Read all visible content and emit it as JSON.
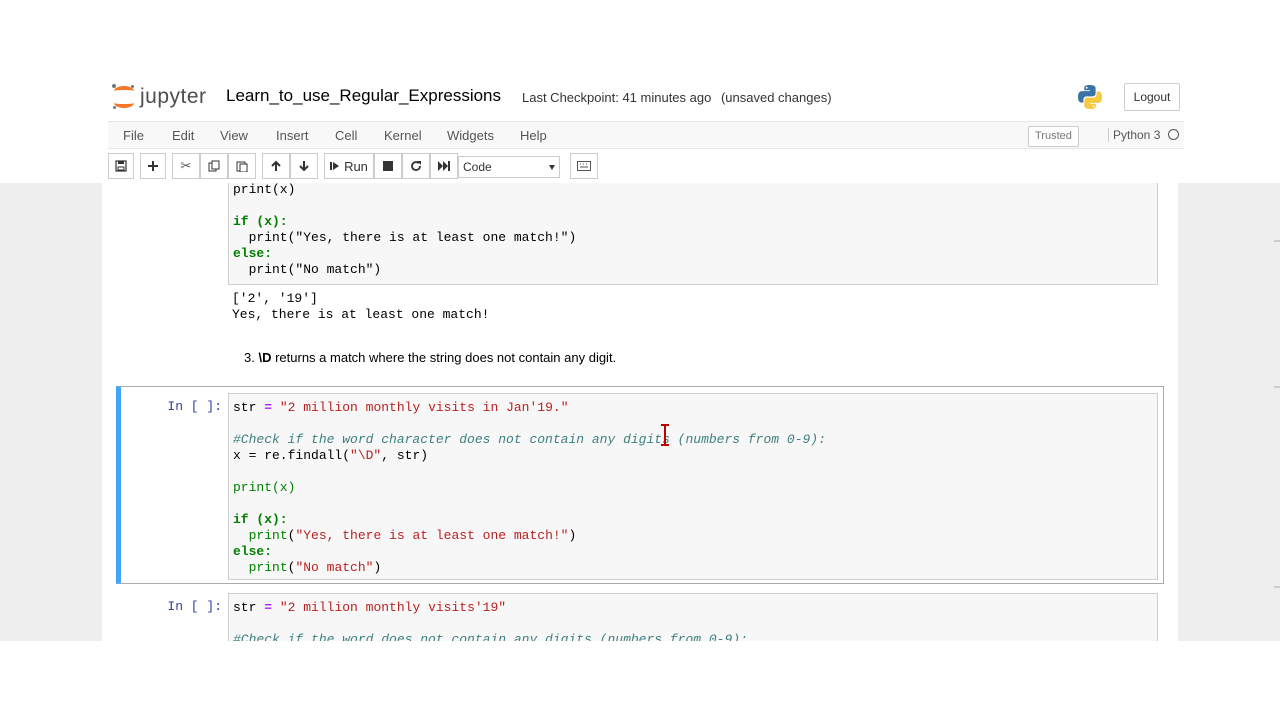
{
  "header": {
    "logo_text": "jupyter",
    "notebook_name": "Learn_to_use_Regular_Expressions",
    "checkpoint": "Last Checkpoint: 41 minutes ago",
    "unsaved": "(unsaved changes)",
    "logout_label": "Logout"
  },
  "menubar": {
    "items": [
      "File",
      "Edit",
      "View",
      "Insert",
      "Cell",
      "Kernel",
      "Widgets",
      "Help"
    ],
    "trusted_label": "Trusted",
    "kernel_name": "Python 3"
  },
  "toolbar": {
    "run_label": "Run",
    "cell_type": "Code"
  },
  "cells": {
    "cell1": {
      "lines": [
        "print(x)",
        "",
        "if (x):",
        "  print(\"Yes, there is at least one match!\")",
        "else:",
        "  print(\"No match\")"
      ],
      "output": [
        "['2', '19']",
        "Yes, there is at least one match!"
      ]
    },
    "markdown": {
      "number": "3.",
      "code": "\\D",
      "text": "returns a match where the string does not contain any digit."
    },
    "cell2": {
      "prompt": "In [ ]:",
      "line1_var": "str",
      "line1_str": "\"2 million monthly visits in Jan'19.\"",
      "comment": "#Check if the word character does not contain any digits (numbers from 0-9):",
      "findall_prefix": "x = re.findall(",
      "findall_pattern": "\"\\D\"",
      "findall_suffix": ", str)",
      "print_x": "print(x)",
      "if_line": "if (x):",
      "print_yes": "\"Yes, there is at least one match!\"",
      "else_line": "else:",
      "print_no": "\"No match\""
    },
    "cell3": {
      "prompt": "In [ ]:",
      "line1_str": "\"2 million monthly visits'19\"",
      "comment": "#Check if the word does not contain any digits (numbers from 0-9):"
    }
  },
  "colors": {
    "prompt": "#303f9f",
    "selected_border": "#42a5f5",
    "logo_orange": "#f37726"
  }
}
